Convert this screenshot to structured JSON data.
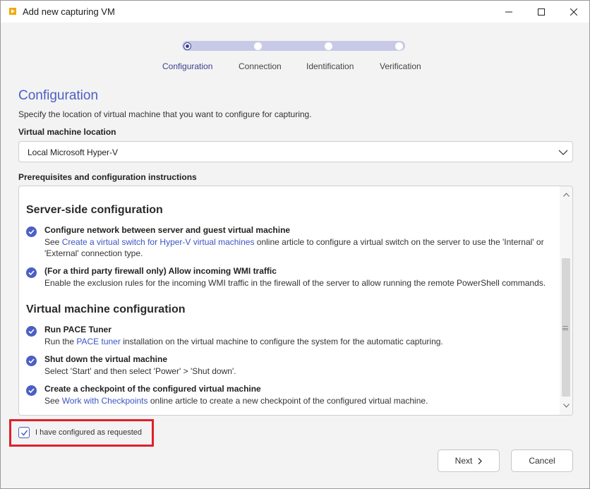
{
  "window": {
    "title": "Add new capturing VM"
  },
  "stepper": {
    "steps": [
      {
        "label": "Configuration",
        "active": true
      },
      {
        "label": "Connection",
        "active": false
      },
      {
        "label": "Identification",
        "active": false
      },
      {
        "label": "Verification",
        "active": false
      }
    ]
  },
  "page": {
    "heading": "Configuration",
    "subtitle": "Specify the location of virtual machine that you want to configure for capturing."
  },
  "vm_location": {
    "label": "Virtual machine location",
    "selected": "Local Microsoft Hyper-V"
  },
  "instructions": {
    "label": "Prerequisites and configuration instructions",
    "sections": [
      {
        "title": "Server-side configuration",
        "items": [
          {
            "title": "Configure network between server and guest virtual machine",
            "desc_before": "See ",
            "link": "Create a virtual switch for Hyper-V virtual machines",
            "desc_after": " online article to configure a virtual switch on the server to use the 'Internal' or 'External' connection type."
          },
          {
            "title": "(For a third party firewall only) Allow incoming WMI traffic",
            "desc_before": "Enable the exclusion rules for the incoming WMI traffic in the firewall of the server to allow running the remote PowerShell commands.",
            "link": "",
            "desc_after": ""
          }
        ]
      },
      {
        "title": "Virtual machine configuration",
        "items": [
          {
            "title": "Run PACE Tuner",
            "desc_before": "Run the ",
            "link": "PACE tuner",
            "desc_after": " installation on the virtual machine to configure the system for the automatic capturing."
          },
          {
            "title": "Shut down the virtual machine",
            "desc_before": "Select 'Start' and then select 'Power' > 'Shut down'.",
            "link": "",
            "desc_after": ""
          },
          {
            "title": "Create a checkpoint of the configured virtual machine",
            "desc_before": "See ",
            "link": "Work with Checkpoints",
            "desc_after": " online article to create a new checkpoint of the configured virtual machine."
          }
        ]
      }
    ]
  },
  "confirm": {
    "label": "I have configured as requested",
    "checked": true
  },
  "buttons": {
    "next": "Next",
    "cancel": "Cancel"
  },
  "colors": {
    "accent": "#4b5fc4",
    "highlight": "#e0202a",
    "link": "#3a55c4"
  },
  "icons": {
    "app": "app-logo-icon",
    "minimize": "minimize-icon",
    "maximize": "maximize-icon",
    "close": "close-icon",
    "check": "check-circle-icon",
    "chevron": "chevron-down-icon"
  }
}
